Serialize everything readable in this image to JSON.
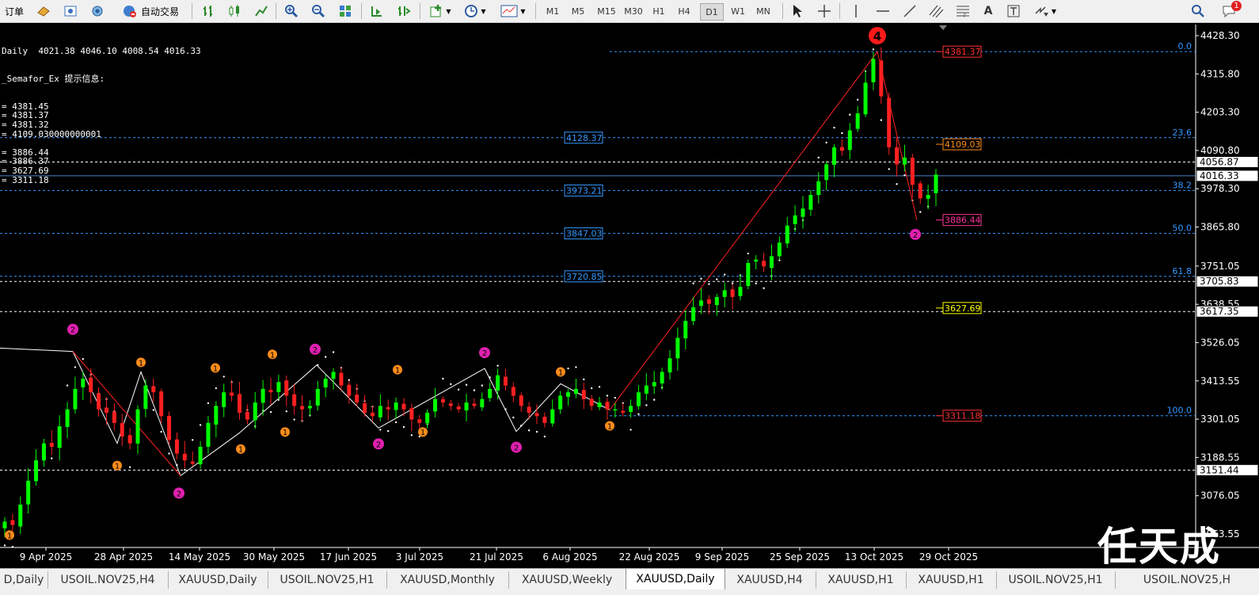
{
  "toolbar": {
    "order_label": "订单",
    "autotrade_label": "自动交易",
    "timeframes": [
      "M1",
      "M5",
      "M15",
      "M30",
      "H1",
      "H4",
      "D1",
      "W1",
      "MN"
    ],
    "active_timeframe": "D1",
    "notification_count": "1"
  },
  "info_panel": {
    "header": "Daily  4021.38 4046.10 4008.54 4016.33",
    "indicator": "_Semafor_Ex 提示信息:",
    "lines": [
      "= 4381.45",
      "= 4381.37",
      "= 4381.32",
      "= 4109.030000000001",
      "",
      "= 3886.44",
      "= 3886.37",
      "= 3627.69",
      "= 3311.18"
    ]
  },
  "chart_data": {
    "type": "candlestick",
    "symbol": "XAUUSD",
    "period": "Daily",
    "ohlc": [
      4021.38,
      4046.1,
      4008.54,
      4016.33
    ],
    "ylim": [
      2955,
      4455
    ],
    "yticks": [
      4428.3,
      4315.8,
      4203.3,
      4090.8,
      3978.3,
      3865.8,
      3751.05,
      3638.55,
      3526.05,
      3413.55,
      3301.05,
      3188.55,
      3076.05,
      2963.55
    ],
    "xticks": [
      "9 Apr 2025",
      "28 Apr 2025",
      "14 May 2025",
      "30 May 2025",
      "17 Jun 2025",
      "3 Jul 2025",
      "21 Jul 2025",
      "6 Aug 2025",
      "22 Aug 2025",
      "9 Sep 2025",
      "25 Sep 2025",
      "13 Oct 2025",
      "29 Oct 2025"
    ],
    "price_tags": [
      {
        "value": "4056.87",
        "price": 4056.87,
        "style": "plain"
      },
      {
        "value": "4016.33",
        "price": 4016.33,
        "style": "plain"
      },
      {
        "value": "3705.83",
        "price": 3705.83,
        "style": "plain"
      },
      {
        "value": "3617.35",
        "price": 3617.35,
        "style": "plain"
      },
      {
        "value": "3151.44",
        "price": 3151.44,
        "style": "plain"
      }
    ],
    "fibonacci": [
      {
        "level": "0.0",
        "price": 4381.37
      },
      {
        "level": "23.6",
        "price": 4128.37
      },
      {
        "level": "38.2",
        "price": 3973.21
      },
      {
        "level": "50.0",
        "price": 3847.03
      },
      {
        "level": "61.8",
        "price": 3720.85
      },
      {
        "level": "100.0",
        "price": 3311.18
      }
    ],
    "fib_price_labels": [
      "4128.37",
      "3973.21",
      "3847.03",
      "3720.85"
    ],
    "semafor_labels": [
      {
        "text": "4381.37",
        "price": 4381.37,
        "color": "#ff3030"
      },
      {
        "text": "4109.03",
        "price": 4109.03,
        "color": "#ff8c1a"
      },
      {
        "text": "3886.44",
        "price": 3886.44,
        "color": "#ff3399"
      },
      {
        "text": "3627.69",
        "price": 3627.69,
        "color": "#ffff00"
      },
      {
        "text": "3311.18",
        "price": 3311.18,
        "color": "#ff3030"
      }
    ],
    "close_series": [
      3000,
      2990,
      3050,
      3120,
      3180,
      3230,
      3220,
      3280,
      3330,
      3390,
      3420,
      3380,
      3330,
      3320,
      3290,
      3250,
      3230,
      3330,
      3400,
      3380,
      3310,
      3240,
      3200,
      3180,
      3170,
      3220,
      3290,
      3340,
      3380,
      3370,
      3320,
      3300,
      3350,
      3390,
      3380,
      3410,
      3370,
      3340,
      3330,
      3340,
      3390,
      3420,
      3440,
      3400,
      3370,
      3350,
      3320,
      3310,
      3340,
      3330,
      3350,
      3330,
      3300,
      3290,
      3320,
      3360,
      3350,
      3340,
      3330,
      3350,
      3340,
      3360,
      3390,
      3430,
      3400,
      3370,
      3340,
      3320,
      3310,
      3290,
      3330,
      3370,
      3380,
      3390,
      3360,
      3340,
      3350,
      3330,
      3330,
      3320,
      3340,
      3380,
      3400,
      3410,
      3440,
      3480,
      3540,
      3590,
      3630,
      3650,
      3640,
      3660,
      3680,
      3660,
      3690,
      3760,
      3770,
      3750,
      3780,
      3820,
      3870,
      3900,
      3920,
      3960,
      4000,
      4050,
      4100,
      4090,
      4150,
      4200,
      4290,
      4360,
      4250,
      4100,
      4050,
      4070,
      3990,
      3950,
      3960,
      4020
    ]
  },
  "watermark": "任天成",
  "tabs": [
    "D,Daily",
    "USOIL.NOV25,H4",
    "XAUUSD,Daily",
    "USOIL.NOV25,H1",
    "XAUUSD,Monthly",
    "XAUUSD,Weekly",
    "XAUUSD,Daily",
    "XAUUSD,H4",
    "XAUUSD,H1",
    "XAUUSD,H1",
    "USOIL.NOV25,H1",
    "USOIL.NOV25,H"
  ],
  "active_tab": 6,
  "colors": {
    "bull": "#00ff00",
    "bear": "#ff2020",
    "grid": "#1e5aa0",
    "fib": "#3399ff",
    "trend": "#ff2020",
    "zigzag": "#ffffff",
    "semafor_orange": "#ff8c1a",
    "semafor_magenta": "#e020b0"
  }
}
